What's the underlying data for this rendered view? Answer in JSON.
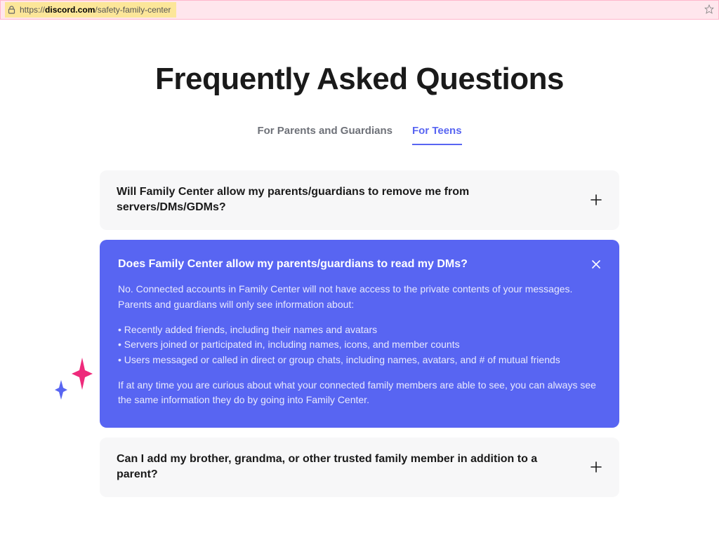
{
  "url": {
    "prefix": "https://",
    "domain": "discord.com",
    "path": "/safety-family-center"
  },
  "heading": "Frequently Asked Questions",
  "tabs": [
    {
      "label": "For Parents and Guardians",
      "active": false
    },
    {
      "label": "For Teens",
      "active": true
    }
  ],
  "faq": [
    {
      "question": "Will Family Center allow my parents/guardians to remove me from servers/DMs/GDMs?",
      "expanded": false
    },
    {
      "question": "Does Family Center allow my parents/guardians to read my DMs?",
      "expanded": true,
      "answer_intro": "No. Connected accounts in Family Center will not have access to the private contents of your messages. Parents and guardians will only see information about:",
      "answer_bullets": [
        "Recently added friends, including their names and avatars",
        "Servers joined or participated in, including names, icons, and member counts",
        "Users messaged or called in direct or group chats, including names, avatars, and # of mutual friends"
      ],
      "answer_outro": "If at any time you are curious about what your connected family members are able to see, you can always see the same information they do by going into Family Center."
    },
    {
      "question": "Can I add my brother, grandma, or other trusted family member in addition to a parent?",
      "expanded": false
    }
  ]
}
